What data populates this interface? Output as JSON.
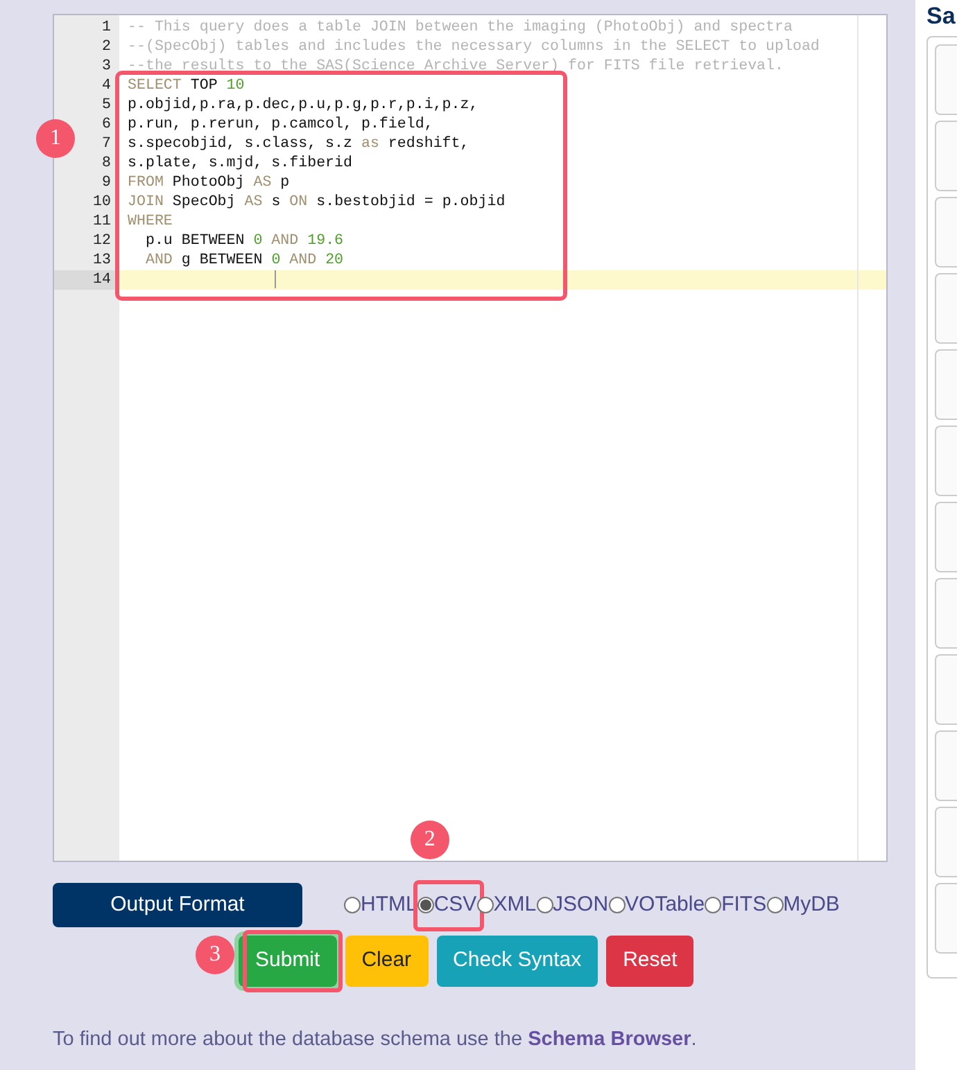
{
  "editor": {
    "lines": [
      {
        "number": "1",
        "active": false,
        "tokens": [
          {
            "kind": "comment",
            "text": "-- This query does a table JOIN between the imaging (PhotoObj) and spectra"
          }
        ]
      },
      {
        "number": "2",
        "active": false,
        "tokens": [
          {
            "kind": "comment",
            "text": "--(SpecObj) tables and includes the necessary columns in the SELECT to upload"
          }
        ]
      },
      {
        "number": "3",
        "active": false,
        "tokens": [
          {
            "kind": "comment",
            "text": "--the results to the SAS(Science Archive Server) for FITS file retrieval."
          }
        ]
      },
      {
        "number": "4",
        "active": false,
        "tokens": [
          {
            "kind": "keyword",
            "text": "SELECT"
          },
          {
            "kind": "plain",
            "text": " TOP "
          },
          {
            "kind": "number",
            "text": "10"
          }
        ]
      },
      {
        "number": "5",
        "active": false,
        "tokens": [
          {
            "kind": "plain",
            "text": "p.objid,p.ra,p.dec,p.u,p.g,p.r,p.i,p.z,"
          }
        ]
      },
      {
        "number": "6",
        "active": false,
        "tokens": [
          {
            "kind": "plain",
            "text": "p.run, p.rerun, p.camcol, p.field,"
          }
        ]
      },
      {
        "number": "7",
        "active": false,
        "tokens": [
          {
            "kind": "plain",
            "text": "s.specobjid, s.class, s.z "
          },
          {
            "kind": "keyword",
            "text": "as"
          },
          {
            "kind": "plain",
            "text": " redshift,"
          }
        ]
      },
      {
        "number": "8",
        "active": false,
        "tokens": [
          {
            "kind": "plain",
            "text": "s.plate, s.mjd, s.fiberid"
          }
        ]
      },
      {
        "number": "9",
        "active": false,
        "tokens": [
          {
            "kind": "keyword",
            "text": "FROM"
          },
          {
            "kind": "plain",
            "text": " PhotoObj "
          },
          {
            "kind": "keyword",
            "text": "AS"
          },
          {
            "kind": "plain",
            "text": " p"
          }
        ]
      },
      {
        "number": "10",
        "active": false,
        "tokens": [
          {
            "kind": "keyword",
            "text": "JOIN"
          },
          {
            "kind": "plain",
            "text": " SpecObj "
          },
          {
            "kind": "keyword",
            "text": "AS"
          },
          {
            "kind": "plain",
            "text": " s "
          },
          {
            "kind": "keyword",
            "text": "ON"
          },
          {
            "kind": "plain",
            "text": " s.bestobjid = p.objid"
          }
        ]
      },
      {
        "number": "11",
        "active": false,
        "tokens": [
          {
            "kind": "keyword",
            "text": "WHERE"
          }
        ]
      },
      {
        "number": "12",
        "active": false,
        "tokens": [
          {
            "kind": "plain",
            "text": "  p.u BETWEEN "
          },
          {
            "kind": "number",
            "text": "0"
          },
          {
            "kind": "keyword",
            "text": " AND "
          },
          {
            "kind": "number",
            "text": "19.6"
          }
        ]
      },
      {
        "number": "13",
        "active": false,
        "tokens": [
          {
            "kind": "keyword",
            "text": "  AND"
          },
          {
            "kind": "plain",
            "text": " g BETWEEN "
          },
          {
            "kind": "number",
            "text": "0"
          },
          {
            "kind": "keyword",
            "text": " AND "
          },
          {
            "kind": "number",
            "text": "20"
          }
        ]
      },
      {
        "number": "14",
        "active": true
      }
    ]
  },
  "output_format": {
    "label": "Output Format",
    "options": [
      {
        "label": "HTML",
        "selected": false
      },
      {
        "label": "CSV",
        "selected": true
      },
      {
        "label": "XML",
        "selected": false
      },
      {
        "label": "JSON",
        "selected": false
      },
      {
        "label": "VOTable",
        "selected": false
      },
      {
        "label": "FITS",
        "selected": false
      },
      {
        "label": "MyDB",
        "selected": false
      }
    ]
  },
  "buttons": [
    {
      "label": "Submit",
      "kind": "success",
      "focused": true
    },
    {
      "label": "Clear",
      "kind": "warning",
      "focused": false
    },
    {
      "label": "Check Syntax",
      "kind": "info",
      "focused": false
    },
    {
      "label": "Reset",
      "kind": "danger",
      "focused": false
    }
  ],
  "footer": {
    "text": "To find out more about the database schema use the ",
    "link": "Schema Browser",
    "end": "."
  },
  "side_panel": {
    "heading": "Sa"
  },
  "annotations": [
    {
      "label": "1"
    },
    {
      "label": "2"
    },
    {
      "label": "3"
    }
  ]
}
